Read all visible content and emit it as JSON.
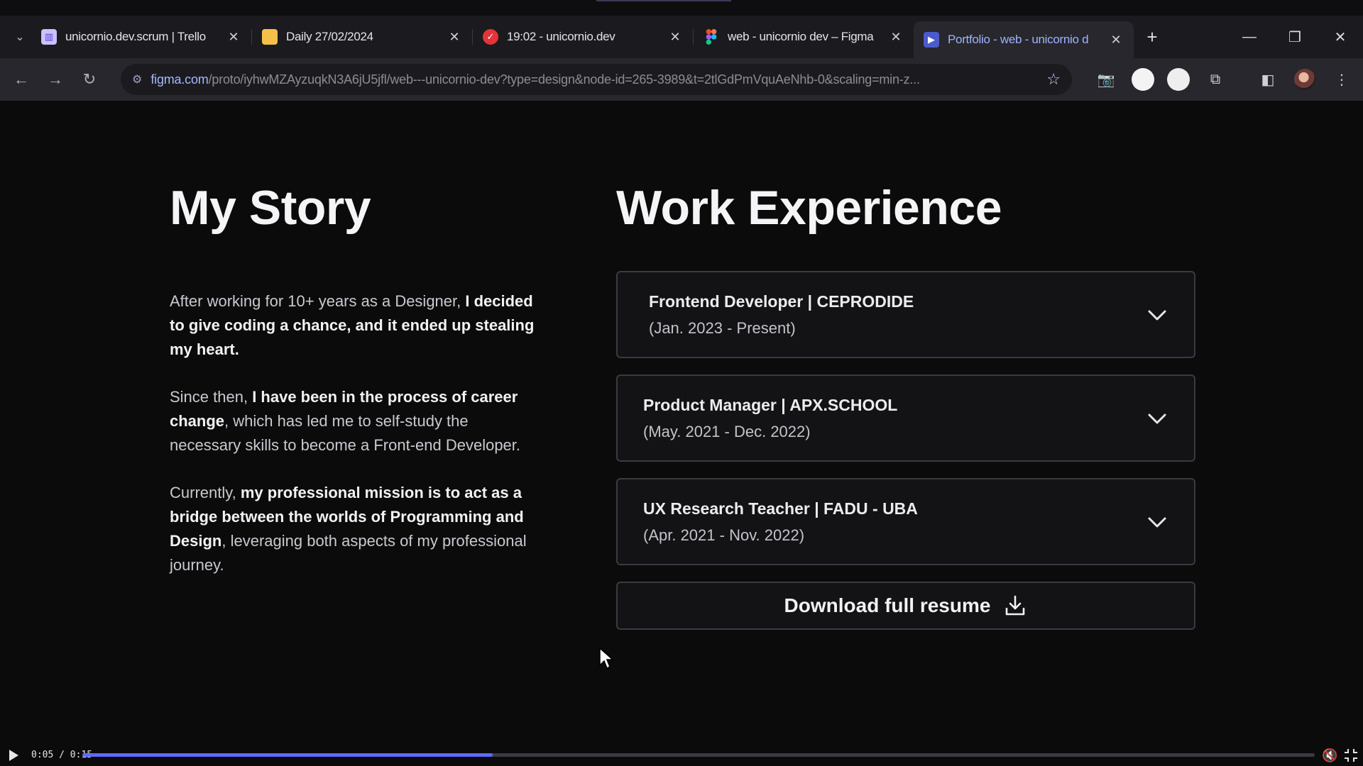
{
  "browser": {
    "tabs": [
      {
        "title": "unicornio.dev.scrum | Trello",
        "favicon": "trello-icon",
        "active": false
      },
      {
        "title": "Daily 27/02/2024",
        "favicon": "notes-icon",
        "active": false
      },
      {
        "title": "19:02 - unicornio.dev",
        "favicon": "check-circle-icon",
        "active": false
      },
      {
        "title": "web - unicornio dev – Figma",
        "favicon": "figma-icon",
        "active": false
      },
      {
        "title": "Portfolio - web - unicornio d",
        "favicon": "play-icon",
        "active": true
      }
    ],
    "new_tab": "+",
    "address": {
      "host": "figma.com",
      "path": "/proto/iyhwMZAyzuqkN3A6jU5jfl/web---unicornio-dev?type=design&node-id=265-3989&t=2tlGdPmVquAeNhb-0&scaling=min-z..."
    },
    "accent": "#9db4ff"
  },
  "page": {
    "story": {
      "title": "My Story",
      "p1_a": "After working for 10+ years as a Designer, ",
      "p1_b": "I decided to give coding a chance, and it ended up stealing my heart.",
      "p2_a": "Since then, ",
      "p2_b": "I have been in the process of career change",
      "p2_c": ", which has led me to self-study the necessary skills to become a Front-end Developer.",
      "p3_a": "Currently, ",
      "p3_b": "my professional mission is to act as a bridge between the worlds of Programming and Design",
      "p3_c": ", leveraging both aspects of my professional journey."
    },
    "work": {
      "title": "Work Experience",
      "items": [
        {
          "role": "Frontend Developer | CEPRODIDE",
          "dates": "(Jan. 2023 - Present)"
        },
        {
          "role": "Product Manager | APX.SCHOOL",
          "dates": "(May. 2021 - Dec. 2022)"
        },
        {
          "role": "UX Research Teacher | FADU - UBA",
          "dates": "(Apr. 2021 - Nov. 2022)"
        }
      ],
      "download_label": "Download full resume"
    }
  },
  "player": {
    "time": "0:05 / 0:15",
    "progress": 0.333,
    "accent": "#5b6cff"
  }
}
